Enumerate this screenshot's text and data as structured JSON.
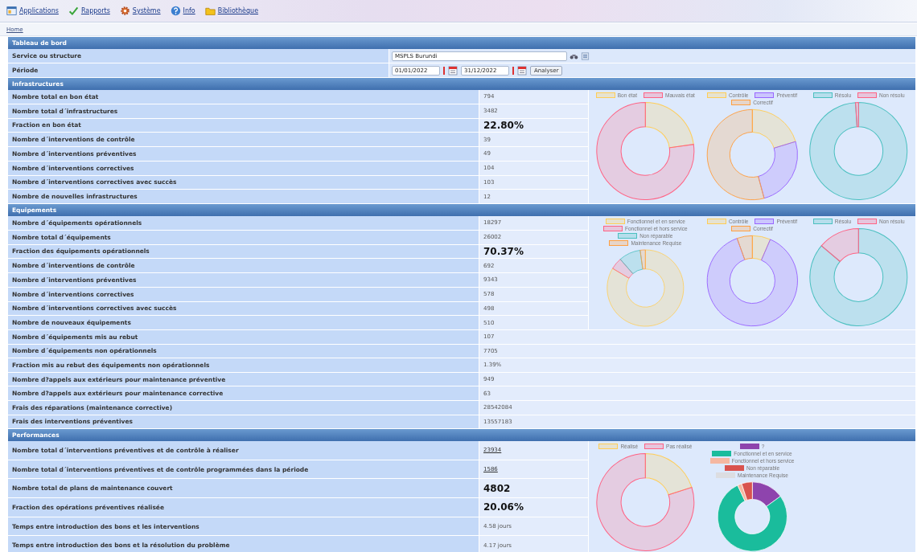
{
  "menu": [
    {
      "label": "Applications"
    },
    {
      "label": "Rapports"
    },
    {
      "label": "Système"
    },
    {
      "label": "Info"
    },
    {
      "label": "Bibliothèque"
    }
  ],
  "breadcrumb": "Home",
  "dashboard": {
    "title": "Tableau de bord",
    "service": {
      "label": "Service ou structure",
      "value": "MSPLS Burundi"
    },
    "period": {
      "label": "Période",
      "from": "01/01/2022",
      "to": "31/12/2022",
      "button": "Analyser"
    }
  },
  "sections": [
    {
      "title": "Infrastructures",
      "rows": [
        {
          "label": "Nombre total en bon état",
          "value": "794",
          "kind": "plain"
        },
        {
          "label": "Nombre total d´infrastructures",
          "value": "3482",
          "kind": "plain"
        },
        {
          "label": "Fraction en bon état",
          "value": "22.80%",
          "kind": "big"
        },
        {
          "label": "Nombre d´interventions de contrôle",
          "value": "39",
          "kind": "plain"
        },
        {
          "label": "Nombre d´interventions préventives",
          "value": "49",
          "kind": "plain"
        },
        {
          "label": "Nombre d´interventions correctives",
          "value": "104",
          "kind": "plain"
        },
        {
          "label": "Nombre d´interventions correctives avec succès",
          "value": "103",
          "kind": "plain"
        },
        {
          "label": "Nombre de nouvelles infrastructures",
          "value": "12",
          "kind": "plain"
        }
      ],
      "charts": [
        {
          "kind": "pale",
          "chart_data": {
            "type": "donut",
            "legend": "top",
            "categories": [
              "Bon état",
              "Mauvais état"
            ],
            "colors": [
              "#ffcd56",
              "#ff6384"
            ],
            "values": [
              22.8,
              77.2
            ]
          }
        },
        {
          "kind": "pale",
          "chart_data": {
            "type": "donut",
            "legend": "top",
            "categories": [
              "Contrôle",
              "Préventif",
              "Correctif"
            ],
            "colors": [
              "#ffcd56",
              "#9966ff",
              "#ff9f40"
            ],
            "values": [
              20.3,
              25.5,
              54.2
            ]
          }
        },
        {
          "kind": "pale",
          "chart_data": {
            "type": "donut",
            "legend": "top",
            "categories": [
              "Résolu",
              "Non résolu"
            ],
            "colors": [
              "#4bc0c0",
              "#ff6384"
            ],
            "values": [
              99.0,
              1.0
            ]
          }
        }
      ]
    },
    {
      "title": "Equipements",
      "rows": [
        {
          "label": "Nombre d´équipements opérationnels",
          "value": "18297",
          "kind": "plain"
        },
        {
          "label": "Nombre total d´équipements",
          "value": "26002",
          "kind": "plain"
        },
        {
          "label": "Fraction des équipements opérationnels",
          "value": "70.37%",
          "kind": "big"
        },
        {
          "label": "Nombre d´interventions de contrôle",
          "value": "692",
          "kind": "plain"
        },
        {
          "label": "Nombre d´interventions préventives",
          "value": "9343",
          "kind": "plain"
        },
        {
          "label": "Nombre d´interventions correctives",
          "value": "578",
          "kind": "plain"
        },
        {
          "label": "Nombre d´interventions correctives avec succès",
          "value": "498",
          "kind": "plain"
        },
        {
          "label": "Nombre de nouveaux équipements",
          "value": "510",
          "kind": "plain"
        }
      ],
      "rows_below": [
        {
          "label": "Nombre d´équipements mis au rebut",
          "value": "107",
          "kind": "plain"
        },
        {
          "label": "Nombre d´équipements non opérationnels",
          "value": "7705",
          "kind": "plain"
        },
        {
          "label": "Fraction mis au rebut des équipements non opérationnels",
          "value": "1.39%",
          "kind": "plain"
        },
        {
          "label": "Nombre d?appels aux extérieurs pour maintenance préventive",
          "value": "949",
          "kind": "plain"
        },
        {
          "label": "Nombre d?appels aux extérieurs pour maintenance corrective",
          "value": "63",
          "kind": "plain"
        },
        {
          "label": "Frais des réparations (maintenance corrective)",
          "value": "28542084",
          "kind": "plain"
        },
        {
          "label": "Frais des interventions préventives",
          "value": "13557183",
          "kind": "plain"
        }
      ],
      "charts": [
        {
          "kind": "pale",
          "chart_data": {
            "type": "donut",
            "legend": "top",
            "categories": [
              "Fonctionnel et en service",
              "Fonctionnel et hors service",
              "Non réparable",
              "Maintenance Requise"
            ],
            "colors": [
              "#ffcd56",
              "#ff6384",
              "#4bc0c0",
              "#ff9f40"
            ],
            "values": [
              83.6,
              5.0,
              9.2,
              2.2
            ]
          }
        },
        {
          "kind": "pale",
          "chart_data": {
            "type": "donut",
            "legend": "top",
            "categories": [
              "Contrôle",
              "Préventif",
              "Correctif"
            ],
            "colors": [
              "#ffcd56",
              "#9966ff",
              "#ff9f40"
            ],
            "values": [
              6.5,
              88.0,
              5.5
            ]
          }
        },
        {
          "kind": "pale",
          "chart_data": {
            "type": "donut",
            "legend": "top",
            "categories": [
              "Résolu",
              "Non résolu"
            ],
            "colors": [
              "#4bc0c0",
              "#ff6384"
            ],
            "values": [
              86.2,
              13.8
            ]
          }
        }
      ]
    },
    {
      "title": "Performances",
      "rows": [
        {
          "label": "Nombre total d´interventions préventives et de contrôle à réaliser",
          "value": "23934",
          "kind": "link"
        },
        {
          "label": "Nombre total d´interventions préventives et de contrôle programmées dans la période",
          "value": "1586",
          "kind": "link"
        },
        {
          "label": "Nombre total de plans de maintenance couvert",
          "value": "4802",
          "kind": "big"
        },
        {
          "label": "Fraction des opérations préventives réalisée",
          "value": "20.06%",
          "kind": "big"
        },
        {
          "label": "Temps entre introduction des bons et les interventions",
          "value": "4.58 jours",
          "kind": "plain"
        },
        {
          "label": "Temps entre introduction des bons et la résolution du problème",
          "value": "4.17 jours",
          "kind": "plain"
        }
      ],
      "charts": [
        {
          "kind": "pale",
          "chart_data": {
            "type": "donut",
            "legend": "top",
            "categories": [
              "Réalisé",
              "Pas réalisé"
            ],
            "colors": [
              "#ffcd56",
              "#ff6384"
            ],
            "values": [
              20.06,
              79.94
            ]
          }
        },
        {
          "kind": "solid",
          "chart_data": {
            "type": "donut",
            "legend": "top",
            "categories": [
              "?",
              "Fonctionnel et en service",
              "Fonctionnel et hors service",
              "Non réparable",
              "Maintenance Requise"
            ],
            "colors": [
              "#8e44ad",
              "#1abc9c",
              "#f5b7a1",
              "#d9534f",
              "#dcdde1"
            ],
            "values": [
              15,
              78,
              2,
              5,
              0
            ]
          }
        }
      ]
    }
  ]
}
